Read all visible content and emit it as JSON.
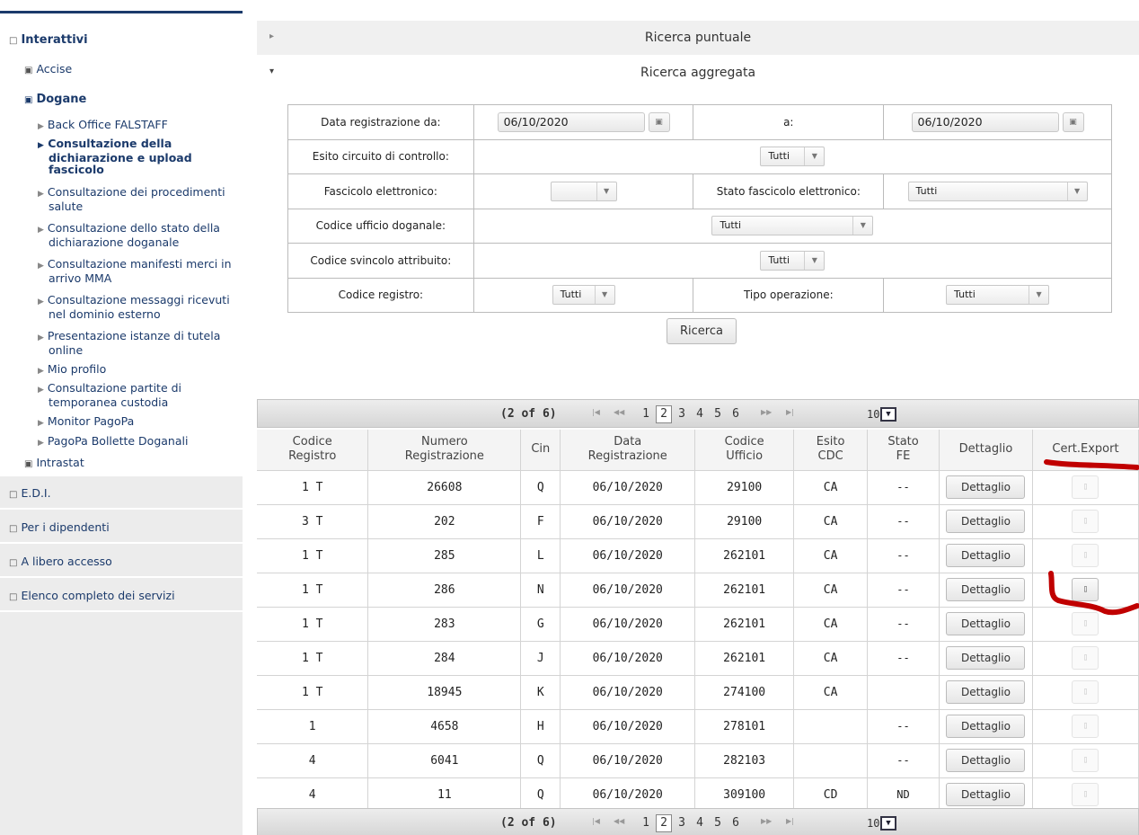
{
  "sidebar": {
    "section": "Interattivi",
    "accise": "Accise",
    "dogane": "Dogane",
    "items": [
      {
        "label": "Back Office FALSTAFF"
      },
      {
        "label": "Consultazione della",
        "label2": "dichiarazione e upload",
        "label3": "fascicolo"
      },
      {
        "label": "Consultazione dei procedimenti",
        "label2": "salute"
      },
      {
        "label": "Consultazione dello stato della",
        "label2": "dichiarazione doganale"
      },
      {
        "label": "Consultazione manifesti merci in",
        "label2": "arrivo MMA"
      },
      {
        "label": "Consultazione messaggi ricevuti",
        "label2": "nel dominio esterno"
      },
      {
        "label": "Presentazione istanze di tutela",
        "label2": "online"
      },
      {
        "label": "Mio profilo"
      },
      {
        "label": "Consultazione partite di",
        "label2": "temporanea custodia"
      },
      {
        "label": "Monitor PagoPa"
      },
      {
        "label": "PagoPa Bollette Doganali"
      }
    ],
    "intrastat": "Intrastat",
    "groups": [
      "E.D.I.",
      "Per i dipendenti",
      "A libero accesso",
      "Elenco completo dei servizi"
    ]
  },
  "accordion": {
    "puntuale": "Ricerca puntuale",
    "aggregata": "Ricerca aggregata"
  },
  "filters": {
    "data_da_label": "Data registrazione da:",
    "data_da_value": "06/10/2020",
    "data_a_label": "a:",
    "data_a_value": "06/10/2020",
    "esito_label": "Esito circuito di controllo:",
    "esito_value": "Tutti",
    "fascicolo_label": "Fascicolo elettronico:",
    "fascicolo_value": "",
    "stato_fascicolo_label": "Stato fascicolo elettronico:",
    "stato_fascicolo_value": "Tutti",
    "ufficio_label": "Codice ufficio doganale:",
    "ufficio_value": "Tutti",
    "svincolo_label": "Codice svincolo attribuito:",
    "svincolo_value": "Tutti",
    "registro_label": "Codice registro:",
    "registro_value": "Tutti",
    "operazione_label": "Tipo operazione:",
    "operazione_value": "Tutti",
    "search_button": "Ricerca"
  },
  "pager": {
    "count": "(2 of 6)",
    "pages": [
      "1",
      "2",
      "3",
      "4",
      "5",
      "6"
    ],
    "current": "2",
    "rows_per_page": "10"
  },
  "table": {
    "headers": [
      {
        "l1": "Codice",
        "l2": "Registro"
      },
      {
        "l1": "Numero",
        "l2": "Registrazione"
      },
      {
        "l1": "Cin",
        "l2": ""
      },
      {
        "l1": "Data",
        "l2": "Registrazione"
      },
      {
        "l1": "Codice",
        "l2": "Ufficio"
      },
      {
        "l1": "Esito",
        "l2": "CDC"
      },
      {
        "l1": "Stato",
        "l2": "FE"
      },
      {
        "l1": "Dettaglio",
        "l2": ""
      },
      {
        "l1": "Cert.Export",
        "l2": ""
      }
    ],
    "detail_label": "Dettaglio",
    "rows": [
      {
        "registro": "1 T",
        "numero": "26608",
        "cin": "Q",
        "data": "06/10/2020",
        "ufficio": "29100",
        "esito": "CA",
        "stato": "--"
      },
      {
        "registro": "3 T",
        "numero": "202",
        "cin": "F",
        "data": "06/10/2020",
        "ufficio": "29100",
        "esito": "CA",
        "stato": "--"
      },
      {
        "registro": "1 T",
        "numero": "285",
        "cin": "L",
        "data": "06/10/2020",
        "ufficio": "262101",
        "esito": "CA",
        "stato": "--"
      },
      {
        "registro": "1 T",
        "numero": "286",
        "cin": "N",
        "data": "06/10/2020",
        "ufficio": "262101",
        "esito": "CA",
        "stato": "--"
      },
      {
        "registro": "1 T",
        "numero": "283",
        "cin": "G",
        "data": "06/10/2020",
        "ufficio": "262101",
        "esito": "CA",
        "stato": "--"
      },
      {
        "registro": "1 T",
        "numero": "284",
        "cin": "J",
        "data": "06/10/2020",
        "ufficio": "262101",
        "esito": "CA",
        "stato": "--"
      },
      {
        "registro": "1 T",
        "numero": "18945",
        "cin": "K",
        "data": "06/10/2020",
        "ufficio": "274100",
        "esito": "CA",
        "stato": ""
      },
      {
        "registro": "1",
        "numero": "4658",
        "cin": "H",
        "data": "06/10/2020",
        "ufficio": "278101",
        "esito": "",
        "stato": "--"
      },
      {
        "registro": "4",
        "numero": "6041",
        "cin": "Q",
        "data": "06/10/2020",
        "ufficio": "282103",
        "esito": "",
        "stato": "--"
      },
      {
        "registro": "4",
        "numero": "11",
        "cin": "Q",
        "data": "06/10/2020",
        "ufficio": "309100",
        "esito": "CD",
        "stato": "ND"
      }
    ]
  },
  "colors": {
    "navy": "#1b3a6b",
    "annotation": "#c00000"
  }
}
